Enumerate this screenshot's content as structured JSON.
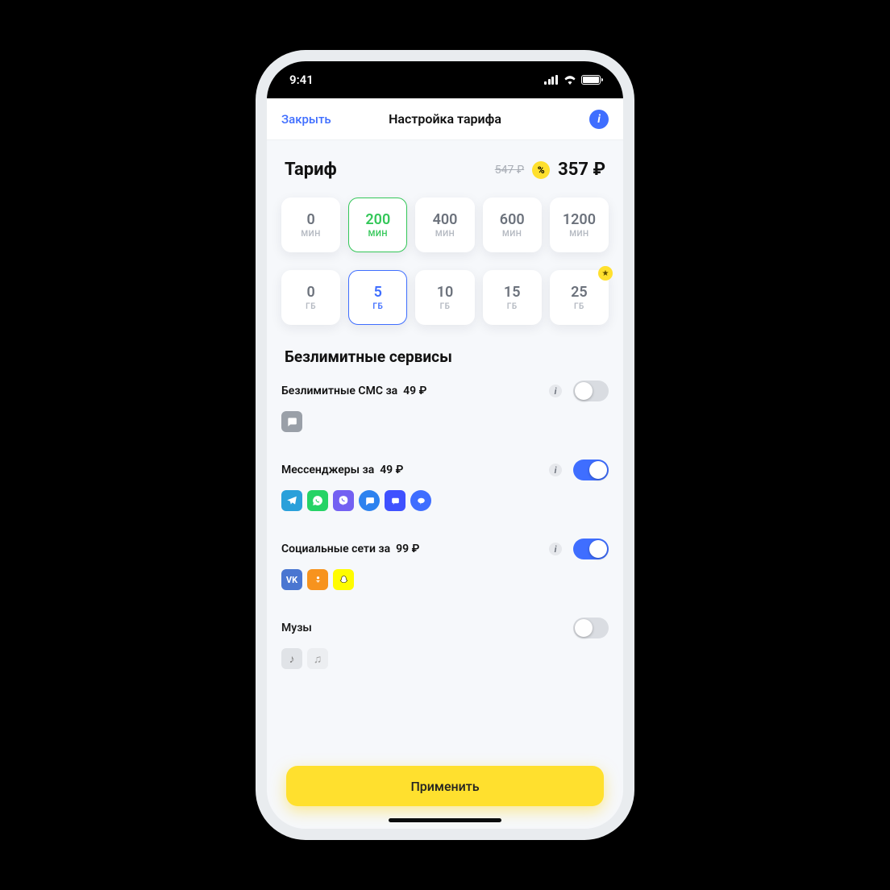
{
  "statusbar": {
    "time": "9:41"
  },
  "nav": {
    "close": "Закрыть",
    "title": "Настройка тарифа"
  },
  "price": {
    "label": "Тариф",
    "old": "547 ₽",
    "discount_glyph": "%",
    "current": "357 ₽"
  },
  "minutes": {
    "unit": "МИН",
    "options": [
      "0",
      "200",
      "400",
      "600",
      "1200"
    ],
    "selected_index": 1
  },
  "data": {
    "unit": "ГБ",
    "options": [
      "0",
      "5",
      "10",
      "15",
      "25"
    ],
    "selected_index": 1,
    "badge_index": 4
  },
  "section_title": "Безлимитные сервисы",
  "services": [
    {
      "label": "Безлимитные СМС за",
      "price": "49 ₽",
      "enabled": false,
      "icons": [
        "sms"
      ]
    },
    {
      "label": "Мессенджеры за",
      "price": "49 ₽",
      "enabled": true,
      "icons": [
        "telegram",
        "whatsapp",
        "viber",
        "imessage",
        "kakao",
        "line"
      ]
    },
    {
      "label": "Социальные сети за",
      "price": "99 ₽",
      "enabled": true,
      "icons": [
        "vk",
        "ok",
        "snapchat"
      ]
    },
    {
      "label": "Музы",
      "price": "",
      "enabled": false,
      "icons": [
        "music",
        "music2"
      ]
    }
  ],
  "apply": "Применить"
}
